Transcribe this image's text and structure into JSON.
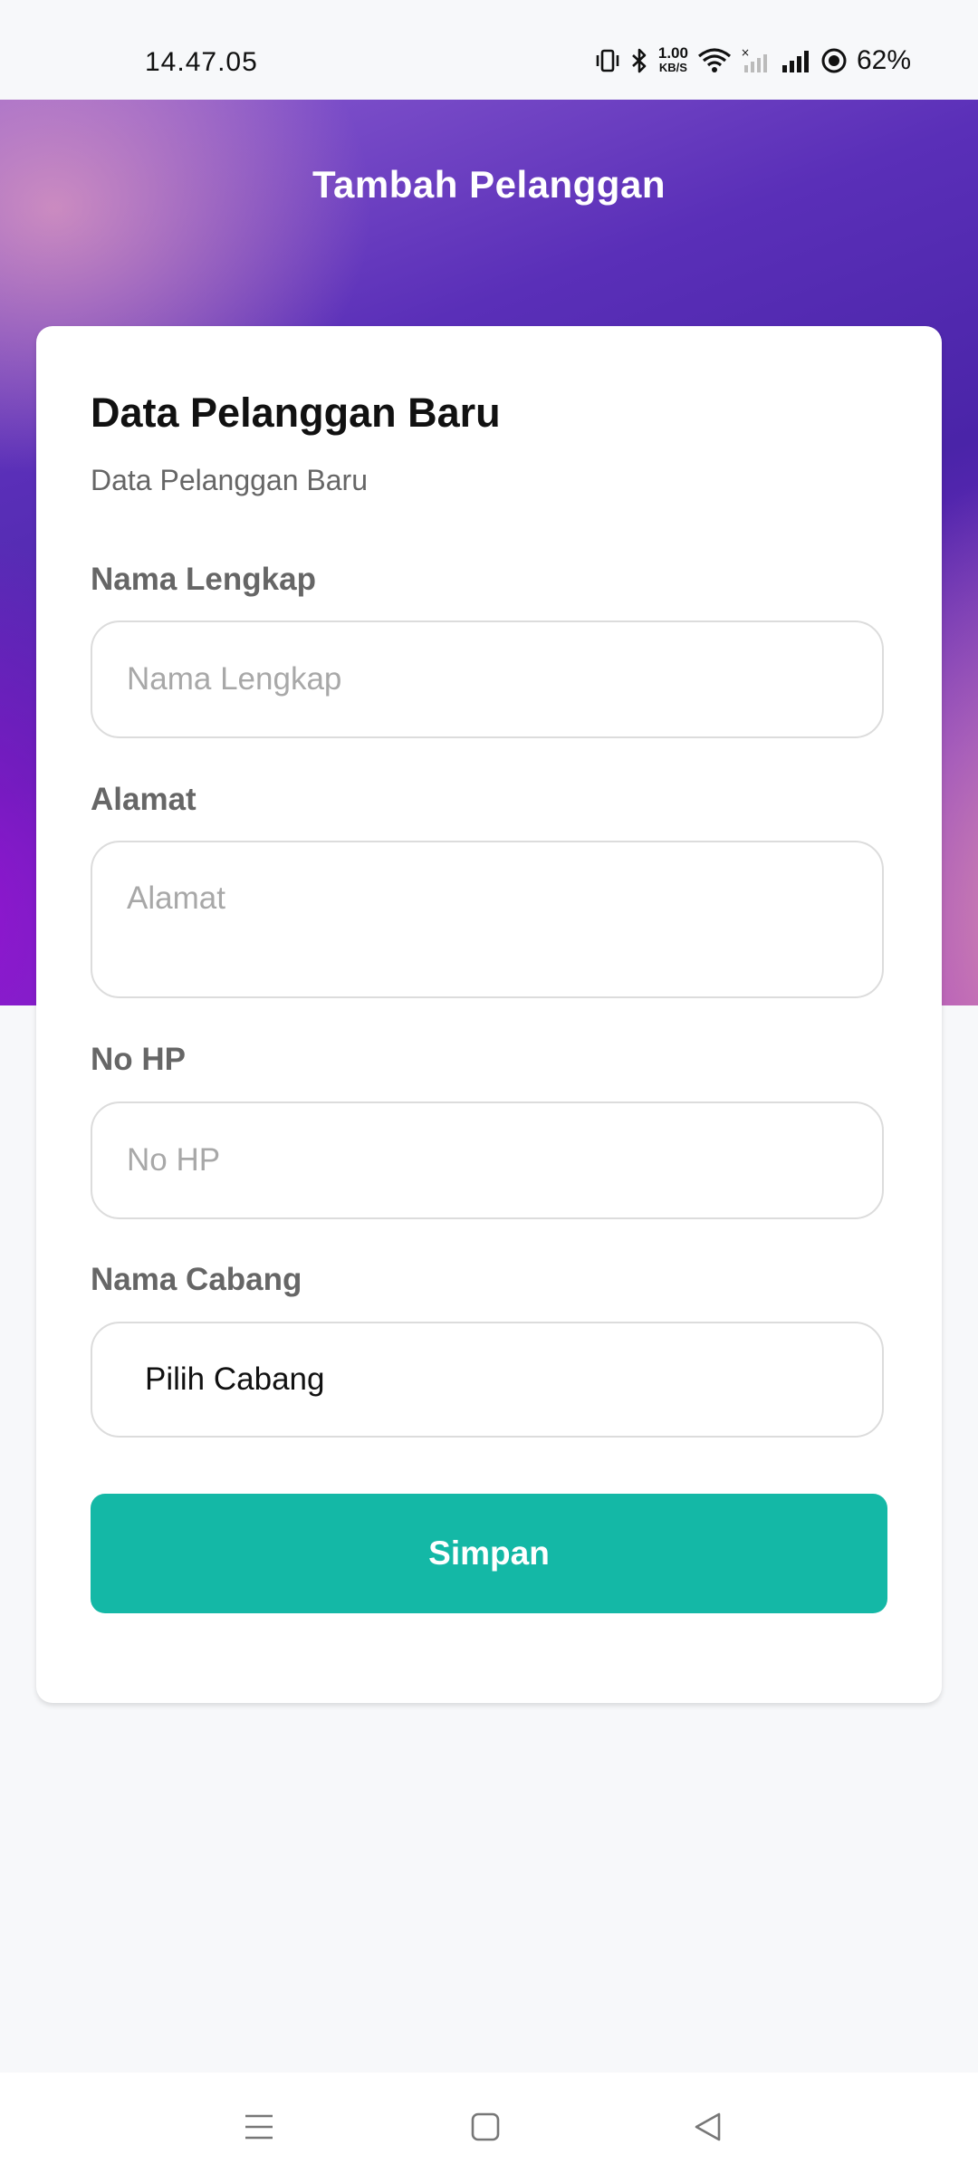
{
  "status_bar": {
    "time": "14.47.05",
    "net_speed_value": "1.00",
    "net_speed_unit": "KB/S",
    "battery": "62%"
  },
  "header": {
    "title": "Tambah Pelanggan"
  },
  "form": {
    "title": "Data Pelanggan Baru",
    "subtitle": "Data Pelanggan Baru",
    "fields": {
      "nama": {
        "label": "Nama Lengkap",
        "placeholder": "Nama Lengkap",
        "value": ""
      },
      "alamat": {
        "label": "Alamat",
        "placeholder": "Alamat",
        "value": ""
      },
      "no_hp": {
        "label": "No HP",
        "placeholder": "No HP",
        "value": ""
      },
      "cabang": {
        "label": "Nama Cabang",
        "selected": "Pilih Cabang"
      }
    },
    "submit_label": "Simpan"
  },
  "colors": {
    "accent": "#14b8a6",
    "header_gradient_main": "#4a24a8"
  },
  "icons": [
    "vibrate-icon",
    "bluetooth-icon",
    "wifi-icon",
    "signal-icon",
    "battery-icon",
    "menu-icon",
    "home-icon",
    "back-icon"
  ]
}
